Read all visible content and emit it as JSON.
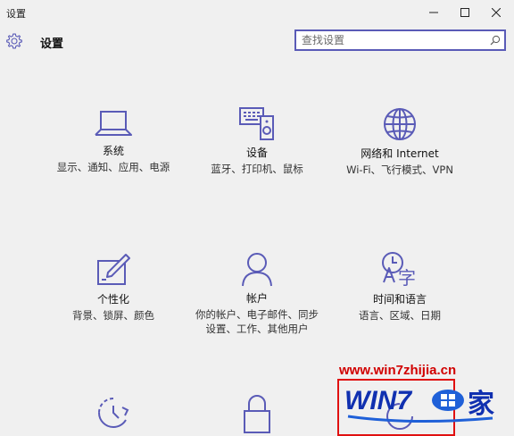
{
  "window": {
    "title": "设置",
    "minimize_glyph": "—",
    "maximize_glyph": "☐",
    "close_glyph": "✕"
  },
  "header": {
    "title": "设置",
    "icon": "gear-icon"
  },
  "search": {
    "placeholder": "查找设置",
    "value": "",
    "icon": "search-icon"
  },
  "accent": "#5a5bb7",
  "tiles": [
    {
      "name": "系统",
      "desc": "显示、通知、应用、电源",
      "icon": "laptop-icon"
    },
    {
      "name": "设备",
      "desc": "蓝牙、打印机、鼠标",
      "icon": "devices-icon"
    },
    {
      "name": "网络和 Internet",
      "desc": "Wi-Fi、飞行模式、VPN",
      "icon": "globe-icon"
    },
    {
      "name": "个性化",
      "desc": "背景、锁屏、颜色",
      "icon": "personalization-icon"
    },
    {
      "name": "帐户",
      "desc": "你的帐户、电子邮件、同步设置、工作、其他用户",
      "icon": "person-icon"
    },
    {
      "name": "时间和语言",
      "desc": "语言、区域、日期",
      "icon": "time-language-icon"
    },
    {
      "name": "",
      "desc": "",
      "icon": "update-icon"
    },
    {
      "name": "",
      "desc": "",
      "icon": "lock-icon"
    },
    {
      "name": "",
      "desc": "",
      "icon": "ease-of-access-icon"
    }
  ],
  "watermark": {
    "url": "www.win7zhijia.cn",
    "logo_text": "WIN7",
    "logo_char": "家"
  }
}
